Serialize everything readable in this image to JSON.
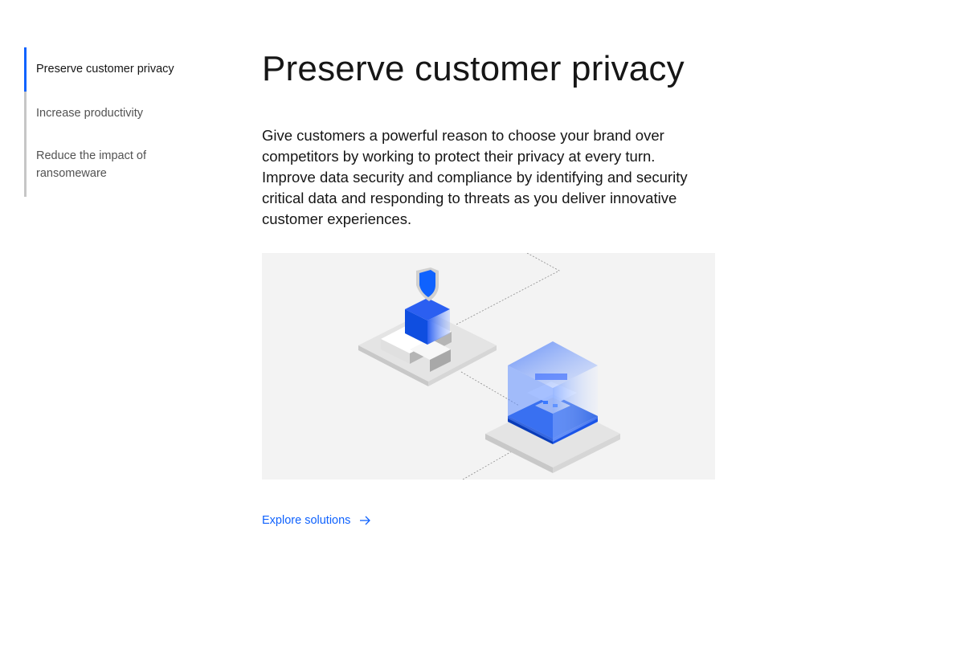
{
  "sidenav": {
    "items": [
      {
        "label": "Preserve customer privacy",
        "active": true
      },
      {
        "label": "Increase productivity",
        "active": false
      },
      {
        "label": "Reduce the impact of ransomeware",
        "active": false
      }
    ]
  },
  "main": {
    "title": "Preserve customer privacy",
    "description": "Give customers a powerful reason to choose your brand over competitors by working to protect their privacy at every turn. Improve data security and compliance by identifying and security critical data and responding to threats as you deliver innovative customer experiences.",
    "illustration_icon": "isometric-privacy-illustration",
    "cta": {
      "label": "Explore solutions",
      "icon": "arrow-right-icon"
    }
  },
  "colors": {
    "accent": "#0f62fe",
    "text_primary": "#161616",
    "text_secondary": "#525252",
    "nav_rail": "#c6c6c6",
    "illustration_bg": "#f3f3f3"
  }
}
